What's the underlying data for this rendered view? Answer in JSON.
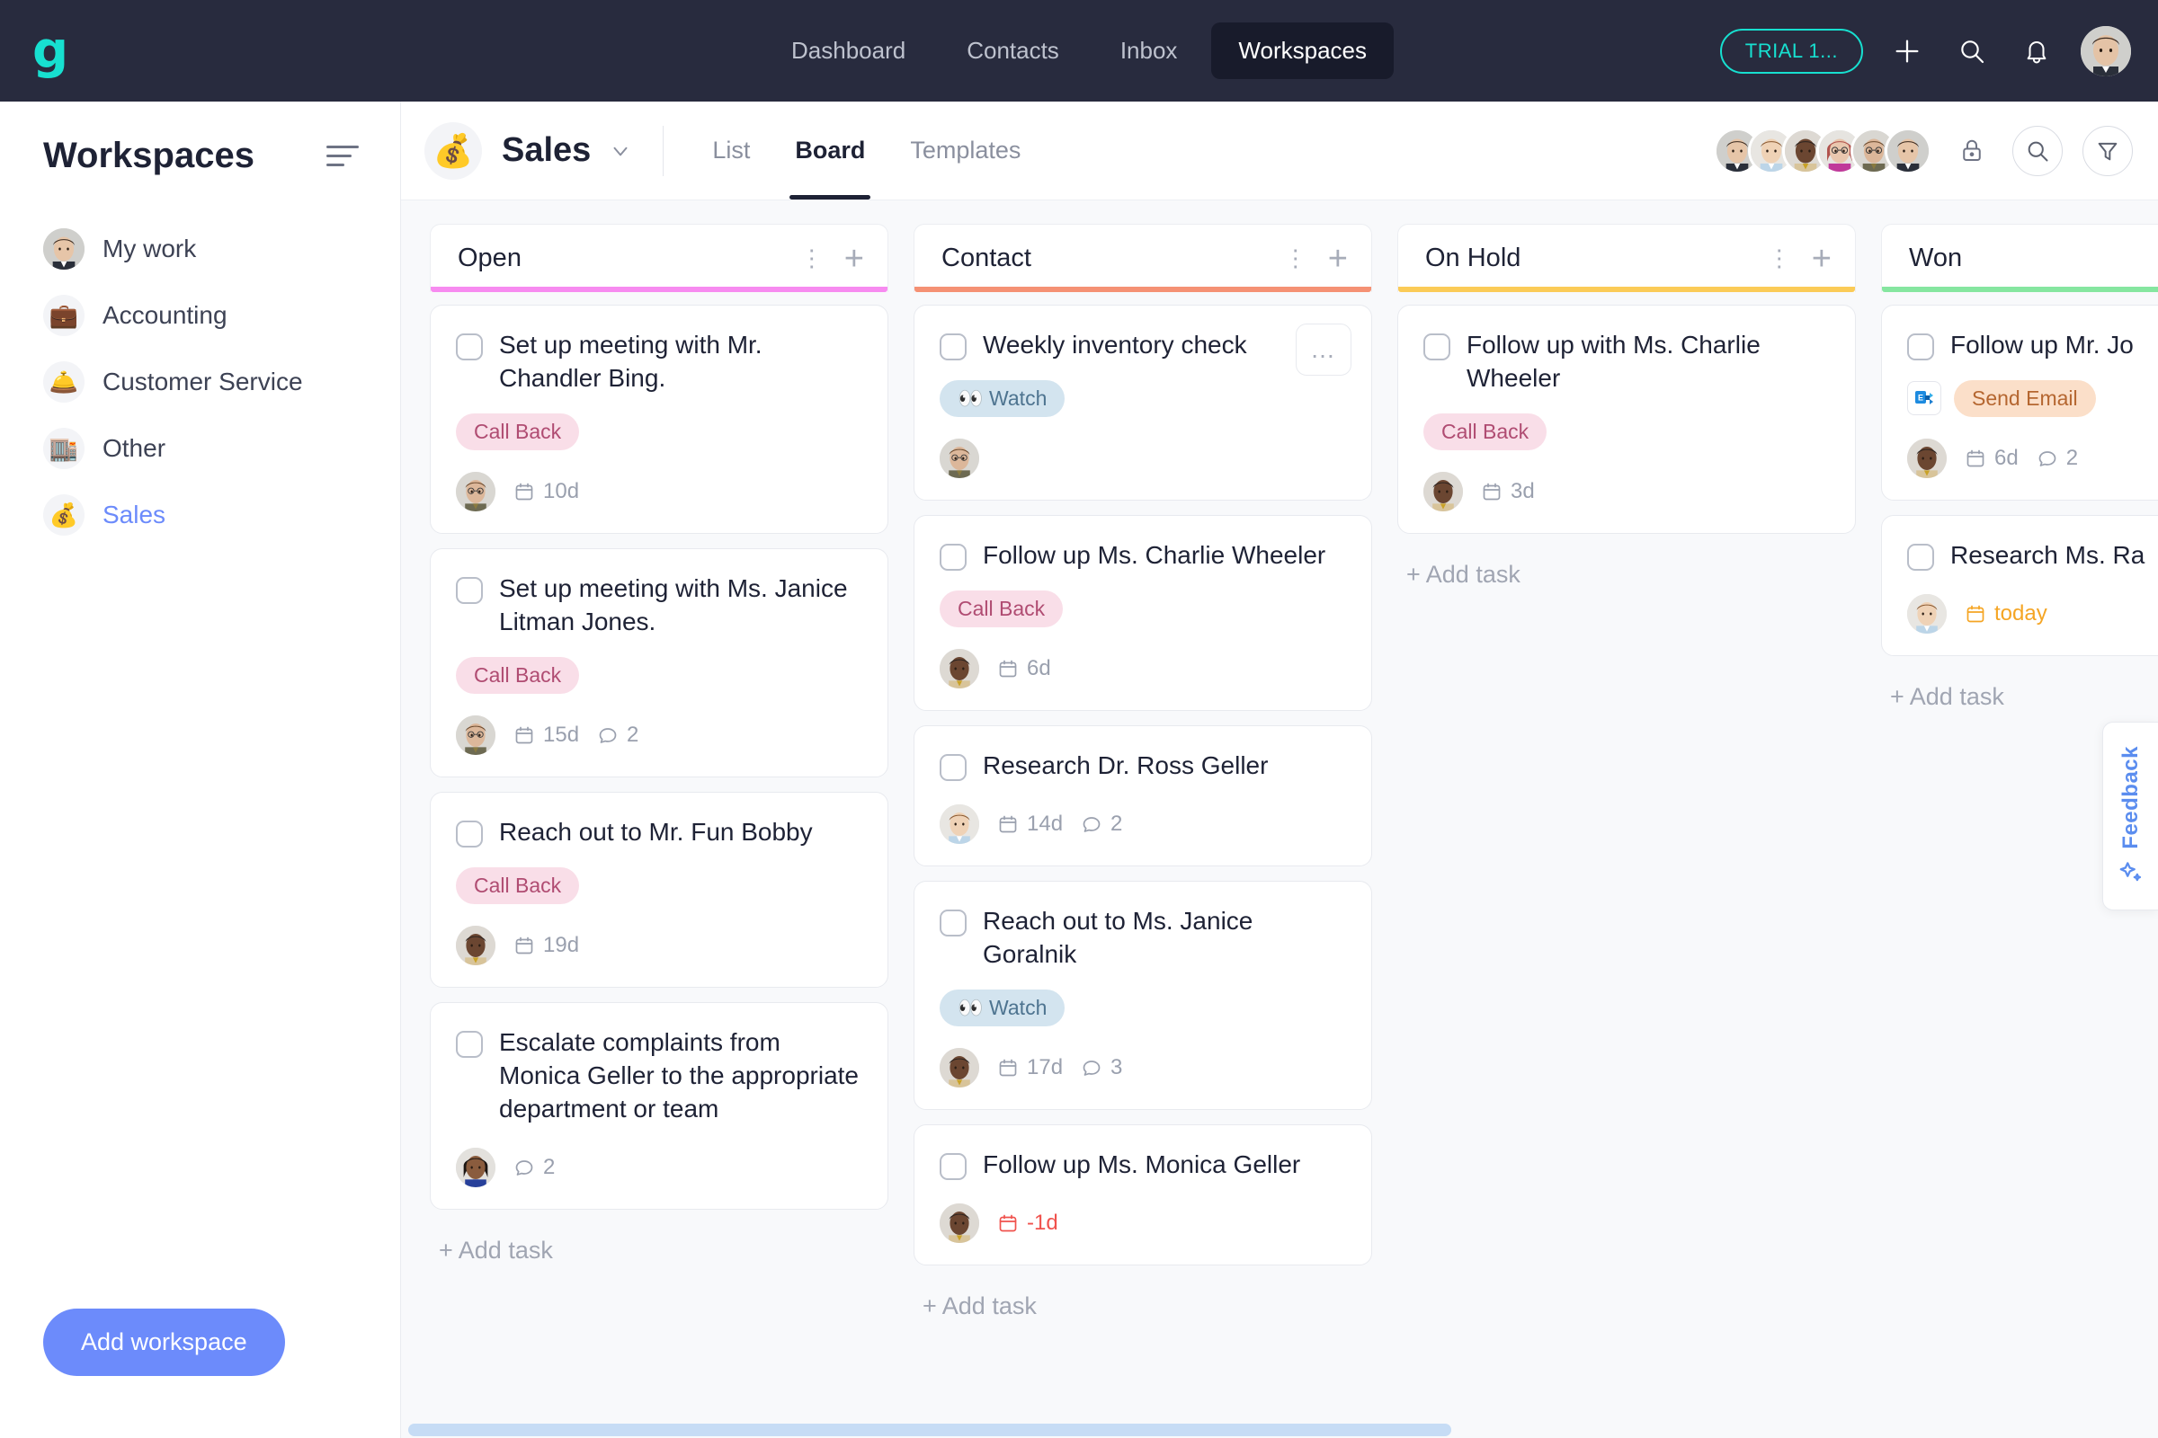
{
  "topnav": {
    "logo": "g",
    "items": [
      {
        "label": "Dashboard",
        "active": false
      },
      {
        "label": "Contacts",
        "active": false
      },
      {
        "label": "Inbox",
        "active": false
      },
      {
        "label": "Workspaces",
        "active": true
      }
    ],
    "trial_label": "TRIAL  1...",
    "icons": [
      "plus-icon",
      "search-icon",
      "bell-icon"
    ],
    "accent": "#17E0D0",
    "background": "#282B3E"
  },
  "sidebar": {
    "title": "Workspaces",
    "items": [
      {
        "label": "My work",
        "icon": "avatar-photo",
        "active": false
      },
      {
        "label": "Accounting",
        "icon": "briefcase-emoji",
        "emoji": "💼",
        "active": false
      },
      {
        "label": "Customer Service",
        "icon": "bellhop-bell-emoji",
        "emoji": "🛎️",
        "active": false
      },
      {
        "label": "Other",
        "icon": "office-building-emoji",
        "emoji": "🏬",
        "active": false
      },
      {
        "label": "Sales",
        "icon": "money-bag-emoji",
        "emoji": "💰",
        "active": true
      }
    ],
    "add_workspace_label": "Add workspace",
    "active_color": "#6C8BFB"
  },
  "board_header": {
    "workspace_emoji": "💰",
    "workspace_name": "Sales",
    "tabs": [
      {
        "label": "List",
        "active": false
      },
      {
        "label": "Board",
        "active": true
      },
      {
        "label": "Templates",
        "active": false
      }
    ],
    "member_count": 6,
    "icons": [
      "lock-icon",
      "search-icon",
      "filter-icon"
    ]
  },
  "board": {
    "add_task_label": "+ Add task",
    "columns": [
      {
        "title": "Open",
        "accent": "#F78BF0",
        "cards": [
          {
            "title": "Set up meeting with Mr. Chandler Bing.",
            "badges": [
              {
                "text": "Call Back",
                "type": "callback"
              }
            ],
            "due": "10d",
            "due_state": "normal",
            "comments": null,
            "assignee": "dwight"
          },
          {
            "title": "Set up meeting with Ms. Janice Litman Jones.",
            "badges": [
              {
                "text": "Call Back",
                "type": "callback"
              }
            ],
            "due": "15d",
            "due_state": "normal",
            "comments": "2",
            "assignee": "dwight"
          },
          {
            "title": "Reach out to Mr. Fun Bobby",
            "badges": [
              {
                "text": "Call Back",
                "type": "callback"
              }
            ],
            "due": "19d",
            "due_state": "normal",
            "comments": null,
            "assignee": "stanley"
          },
          {
            "title": "Escalate complaints from Monica Geller to the appropriate department or team",
            "badges": [],
            "due": null,
            "due_state": "normal",
            "comments": "2",
            "assignee": "kelly"
          }
        ]
      },
      {
        "title": "Contact",
        "accent": "#F59174",
        "cards": [
          {
            "title": "Weekly inventory check",
            "badges": [
              {
                "text": "Watch",
                "type": "watch",
                "emoji": "👀"
              }
            ],
            "due": null,
            "due_state": "normal",
            "comments": null,
            "assignee": "dwight",
            "menu": "..."
          },
          {
            "title": "Follow up Ms. Charlie Wheeler",
            "badges": [
              {
                "text": "Call Back",
                "type": "callback"
              }
            ],
            "due": "6d",
            "due_state": "normal",
            "comments": null,
            "assignee": "stanley"
          },
          {
            "title": "Research Dr. Ross Geller",
            "badges": [],
            "due": "14d",
            "due_state": "normal",
            "comments": "2",
            "assignee": "jim"
          },
          {
            "title": "Reach out to Ms. Janice Goralnik",
            "badges": [
              {
                "text": "Watch",
                "type": "watch",
                "emoji": "👀"
              }
            ],
            "due": "17d",
            "due_state": "normal",
            "comments": "3",
            "assignee": "stanley"
          },
          {
            "title": "Follow up Ms. Monica Geller",
            "badges": [],
            "due": "-1d",
            "due_state": "overdue",
            "comments": null,
            "assignee": "stanley"
          }
        ]
      },
      {
        "title": "On Hold",
        "accent": "#FBCB57",
        "cards": [
          {
            "title": "Follow up with Ms. Charlie Wheeler",
            "badges": [
              {
                "text": "Call Back",
                "type": "callback"
              }
            ],
            "due": "3d",
            "due_state": "normal",
            "comments": null,
            "assignee": "stanley"
          }
        ]
      },
      {
        "title": "Won",
        "accent": "#86E6A0",
        "cards": [
          {
            "title": "Follow up Mr. Jo",
            "badges": [
              {
                "text": "Send Email",
                "type": "email",
                "icon": "microsoft-exchange-icon"
              }
            ],
            "due": "6d",
            "due_state": "normal",
            "comments": "2",
            "assignee": "stanley"
          },
          {
            "title": "Research Ms. Ra",
            "badges": [],
            "due": "today",
            "due_state": "today",
            "comments": null,
            "assignee": "jim"
          }
        ]
      }
    ]
  },
  "feedback": {
    "label": "Feedback",
    "icon": "sparkle-star-icon",
    "color": "#5B8DEF"
  }
}
